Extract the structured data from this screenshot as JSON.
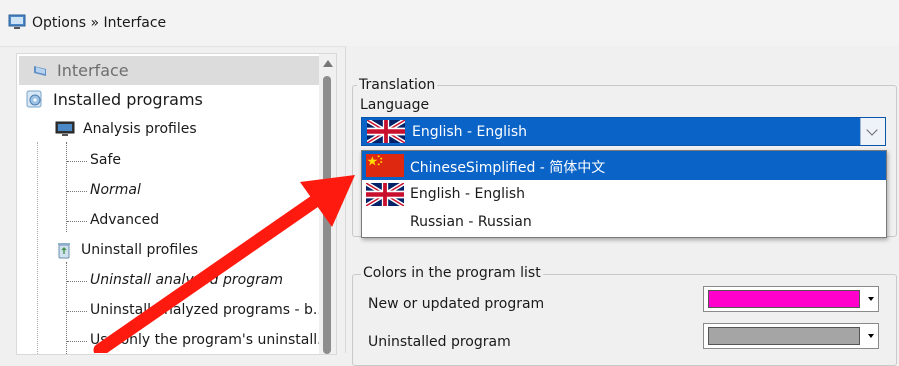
{
  "window": {
    "title": "Options » Interface"
  },
  "tree": {
    "selected": {
      "label": "Interface"
    },
    "installed_programs": {
      "label": "Installed programs"
    },
    "analysis_profiles": {
      "label": "Analysis profiles"
    },
    "safe": {
      "label": "Safe"
    },
    "normal": {
      "label": "Normal"
    },
    "advanced": {
      "label": "Advanced"
    },
    "uninstall_profiles": {
      "label": "Uninstall profiles"
    },
    "uninstall_analyzed": {
      "label": "Uninstall analyzed program"
    },
    "uninstall_analyzed_multi": {
      "label": "Uninstall analyzed programs - b..."
    },
    "use_only": {
      "label": "Use only the program's uninstall..."
    }
  },
  "translation": {
    "group_label": "Translation",
    "language_label": "Language",
    "selected": "English - English",
    "options": [
      {
        "label": "ChineseSimplified - 简体中文",
        "flag": "china-flag"
      },
      {
        "label": "English - English",
        "flag": "uk-flag"
      },
      {
        "label": "Russian - Russian",
        "flag": "none"
      }
    ]
  },
  "colors": {
    "group_label": "Colors in the program list",
    "rows": [
      {
        "label": "New or updated program",
        "color": "#ff00cc"
      },
      {
        "label": "Uninstalled program",
        "color": "#a5a5a5"
      }
    ]
  },
  "annotation": {
    "arrow_color": "#ff1a0f"
  }
}
